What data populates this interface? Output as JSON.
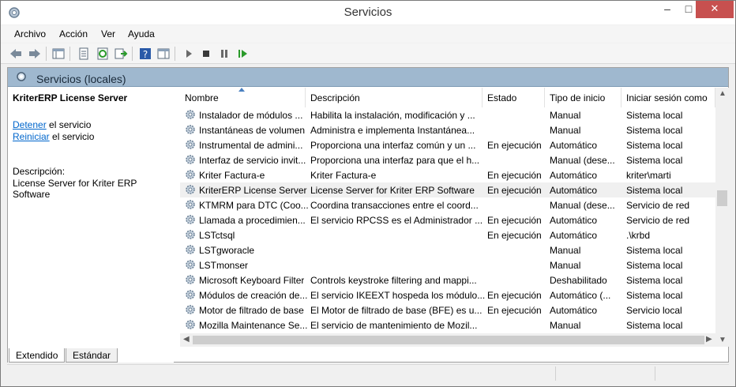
{
  "window": {
    "title": "Servicios"
  },
  "menu": [
    "Archivo",
    "Acción",
    "Ver",
    "Ayuda"
  ],
  "header": {
    "title": "Servicios (locales)"
  },
  "left_pane": {
    "service_name": "KriterERP License Server",
    "stop_link": "Detener",
    "stop_suffix": " el servicio",
    "restart_link": "Reiniciar",
    "restart_suffix": " el servicio",
    "description_label": "Descripción:",
    "description_text": "License Server for Kriter ERP Software"
  },
  "columns": [
    "Nombre",
    "Descripción",
    "Estado",
    "Tipo de inicio",
    "Iniciar sesión como"
  ],
  "rows": [
    {
      "name": "Instalador de módulos ...",
      "desc": "Habilita la instalación, modificación y ...",
      "state": "",
      "startup": "Manual",
      "logon": "Sistema local"
    },
    {
      "name": "Instantáneas de volumen",
      "desc": "Administra e implementa Instantánea...",
      "state": "",
      "startup": "Manual",
      "logon": "Sistema local"
    },
    {
      "name": "Instrumental de admini...",
      "desc": "Proporciona una interfaz común y un ...",
      "state": "En ejecución",
      "startup": "Automático",
      "logon": "Sistema local"
    },
    {
      "name": "Interfaz de servicio invit...",
      "desc": "Proporciona una interfaz para que el h...",
      "state": "",
      "startup": "Manual (dese...",
      "logon": "Sistema local"
    },
    {
      "name": "Kriter Factura-e",
      "desc": "Kriter Factura-e",
      "state": "En ejecución",
      "startup": "Automático",
      "logon": "kriter\\marti"
    },
    {
      "name": "KriterERP License Server",
      "desc": "License Server for Kriter ERP Software",
      "state": "En ejecución",
      "startup": "Automático",
      "logon": "Sistema local"
    },
    {
      "name": "KTMRM para DTC (Coo...",
      "desc": "Coordina transacciones entre el coord...",
      "state": "",
      "startup": "Manual (dese...",
      "logon": "Servicio de red"
    },
    {
      "name": "Llamada a procedimien...",
      "desc": "El servicio RPCSS es el Administrador ...",
      "state": "En ejecución",
      "startup": "Automático",
      "logon": "Servicio de red"
    },
    {
      "name": "LSTctsql",
      "desc": "",
      "state": "En ejecución",
      "startup": "Automático",
      "logon": ".\\krbd"
    },
    {
      "name": "LSTgworacle",
      "desc": "",
      "state": "",
      "startup": "Manual",
      "logon": "Sistema local"
    },
    {
      "name": "LSTmonser",
      "desc": "",
      "state": "",
      "startup": "Manual",
      "logon": "Sistema local"
    },
    {
      "name": "Microsoft Keyboard Filter",
      "desc": "Controls keystroke filtering and mappi...",
      "state": "",
      "startup": "Deshabilitado",
      "logon": "Sistema local"
    },
    {
      "name": "Módulos de creación de...",
      "desc": "El servicio IKEEXT hospeda los módulo...",
      "state": "En ejecución",
      "startup": "Automático (...",
      "logon": "Sistema local"
    },
    {
      "name": "Motor de filtrado de base",
      "desc": "El Motor de filtrado de base (BFE) es u...",
      "state": "En ejecución",
      "startup": "Automático",
      "logon": "Servicio local"
    },
    {
      "name": "Mozilla Maintenance Se...",
      "desc": "El servicio de mantenimiento de Mozil...",
      "state": "",
      "startup": "Manual",
      "logon": "Sistema local"
    }
  ],
  "selected_row": 5,
  "tabs": [
    "Extendido",
    "Estándar"
  ],
  "colors": {
    "header_strip": "#9fb8cf",
    "link": "#0066cc",
    "close_button": "#c7504f"
  }
}
